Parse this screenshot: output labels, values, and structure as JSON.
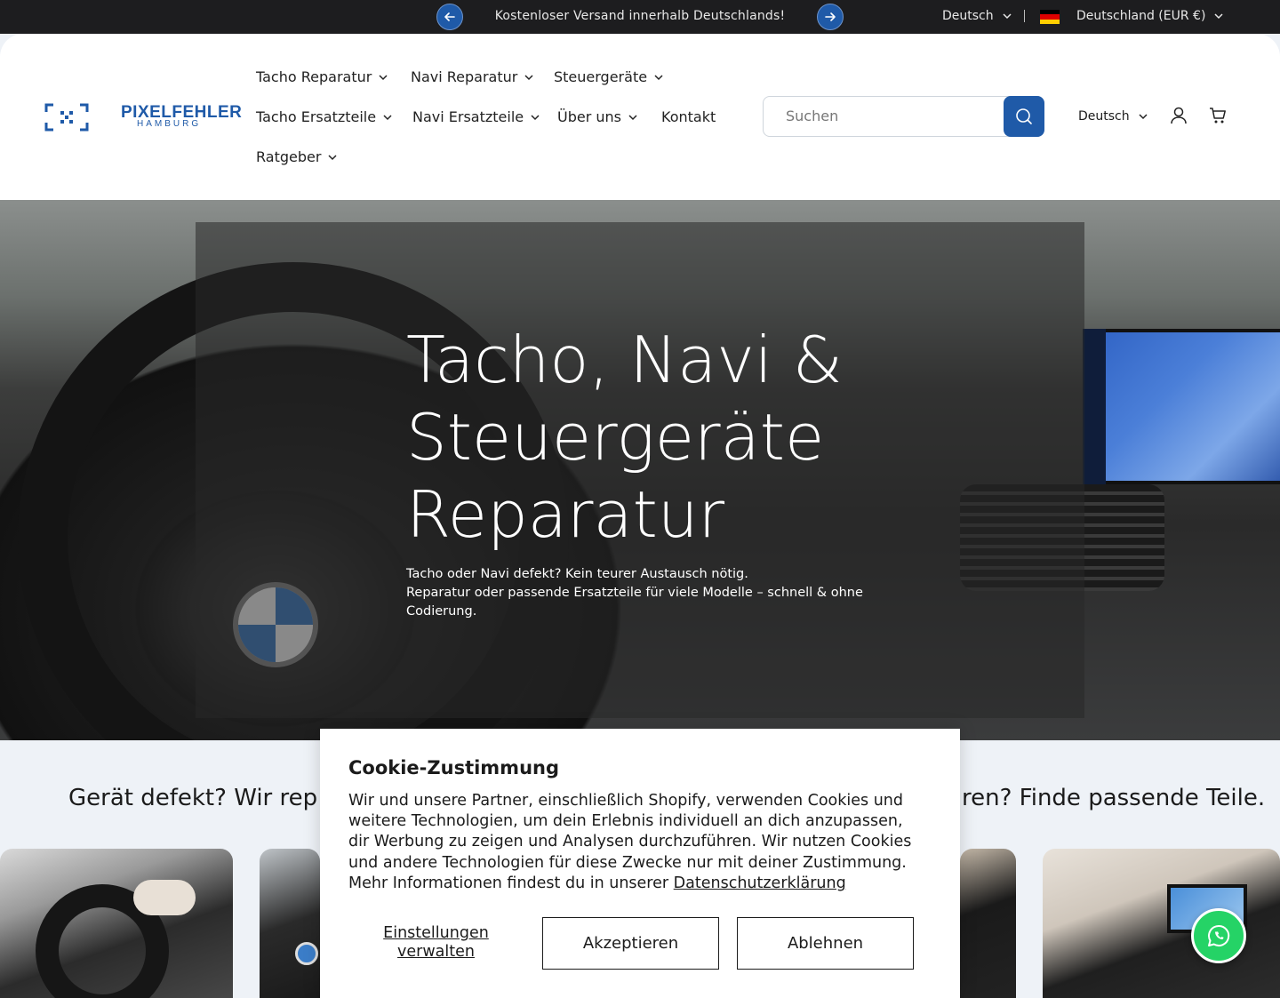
{
  "announcement": {
    "text": "Kostenloser Versand innerhalb Deutschlands!"
  },
  "topbar": {
    "language": "Deutsch",
    "country": "Deutschland (EUR €)"
  },
  "colors": {
    "brand": "#1f5aa8",
    "topbar_bg": "#1d1d1f",
    "whatsapp": "#25d366"
  },
  "logo": {
    "name": "PIXELFEHLER",
    "sub": "HAMBURG"
  },
  "nav": [
    {
      "label": "Tacho Reparatur",
      "dropdown": true
    },
    {
      "label": "Navi Reparatur",
      "dropdown": true
    },
    {
      "label": "Steuergeräte",
      "dropdown": true
    },
    {
      "label": "Tacho Ersatzteile",
      "dropdown": true
    },
    {
      "label": "Navi Ersatzteile",
      "dropdown": true
    },
    {
      "label": "Über uns",
      "dropdown": true
    },
    {
      "label": "Kontakt",
      "dropdown": false
    },
    {
      "label": "Ratgeber",
      "dropdown": true
    }
  ],
  "search": {
    "placeholder": "Suchen",
    "icon": "search-icon"
  },
  "header": {
    "language": "Deutsch",
    "account_icon": "user-icon",
    "cart_icon": "cart-icon"
  },
  "hero": {
    "title_lines": [
      "Tacho, Navi &",
      "Steuergeräte",
      "Reparatur"
    ],
    "sub_lines": [
      "Tacho oder Navi defekt? Kein teurer Austausch nötig.",
      "Reparatur oder passende Ersatzteile für viele Modelle – schnell & ohne Codierung."
    ]
  },
  "section": {
    "title_left": "Gerät defekt? Wir rep",
    "title_right": "ren? Finde passende Teile."
  },
  "cookie": {
    "title": "Cookie-Zustimmung",
    "text": "Wir und unsere Partner, einschließlich Shopify, verwenden Cookies und weitere Technologien, um dein Erlebnis individuell an dich anzupassen, dir Werbung zu zeigen und Analysen durchzuführen. Wir nutzen Cookies und andere Technologien für diese Zwecke nur mit deiner Zustimmung. Mehr Informationen findest du in unserer",
    "link": "Datenschutzerklärung",
    "manage": "Einstellungen verwalten",
    "accept": "Akzeptieren",
    "decline": "Ablehnen"
  }
}
